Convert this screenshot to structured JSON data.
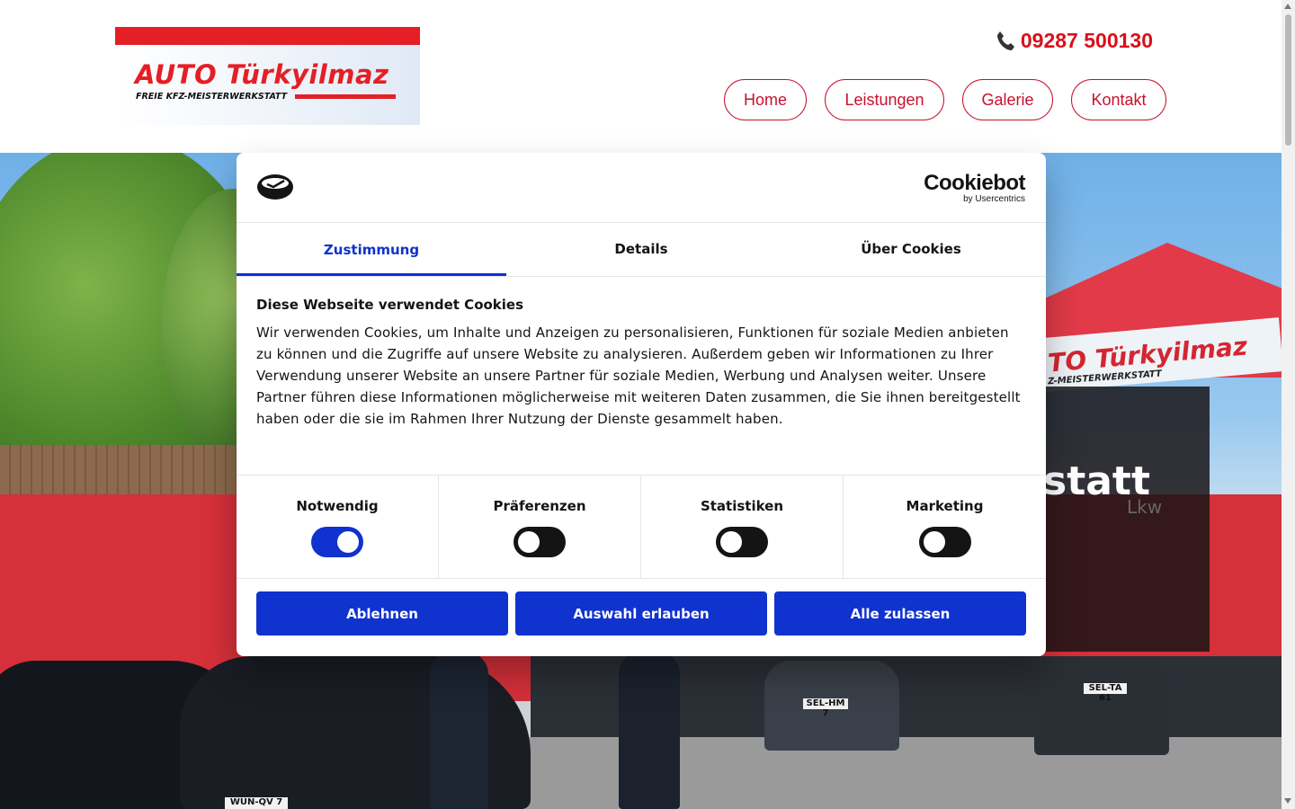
{
  "header": {
    "logo": {
      "title": "AUTO Türkyilmaz",
      "subtitle": "FREIE KFZ-MEISTERWERKSTATT"
    },
    "phone": "09287 500130",
    "nav": [
      {
        "label": "Home"
      },
      {
        "label": "Leistungen"
      },
      {
        "label": "Galerie"
      },
      {
        "label": "Kontakt"
      }
    ],
    "brand_color": "#d9101a"
  },
  "hero": {
    "partial_heading": "statt",
    "partial_sub": "Lkw",
    "sign_text": "TO Türkyilmaz",
    "sign_sub": "Z-MEISTERWERKSTATT",
    "plates": [
      "WUN-QV 7",
      "SEL-HM 7",
      "SEL-TA 61"
    ]
  },
  "cookie_dialog": {
    "brand": "Cookiebot",
    "brand_by": "by Usercentrics",
    "tabs": [
      {
        "label": "Zustimmung",
        "active": true
      },
      {
        "label": "Details",
        "active": false
      },
      {
        "label": "Über Cookies",
        "active": false
      }
    ],
    "title": "Diese Webseite verwendet Cookies",
    "text": "Wir verwenden Cookies, um Inhalte und Anzeigen zu personalisieren, Funktionen für soziale Medien anbieten zu können und die Zugriffe auf unsere Website zu analysieren. Außerdem geben wir Informationen zu Ihrer Verwendung unserer Website an unsere Partner für soziale Medien, Werbung und Analysen weiter. Unsere Partner führen diese Informationen möglicherweise mit weiteren Daten zusammen, die Sie ihnen bereitgestellt haben oder die sie im Rahmen Ihrer Nutzung der Dienste gesammelt haben.",
    "toggles": [
      {
        "label": "Notwendig",
        "on": true
      },
      {
        "label": "Präferenzen",
        "on": false
      },
      {
        "label": "Statistiken",
        "on": false
      },
      {
        "label": "Marketing",
        "on": false
      }
    ],
    "buttons": [
      {
        "label": "Ablehnen"
      },
      {
        "label": "Auswahl erlauben"
      },
      {
        "label": "Alle zulassen"
      }
    ],
    "accent_color": "#1032cf"
  }
}
